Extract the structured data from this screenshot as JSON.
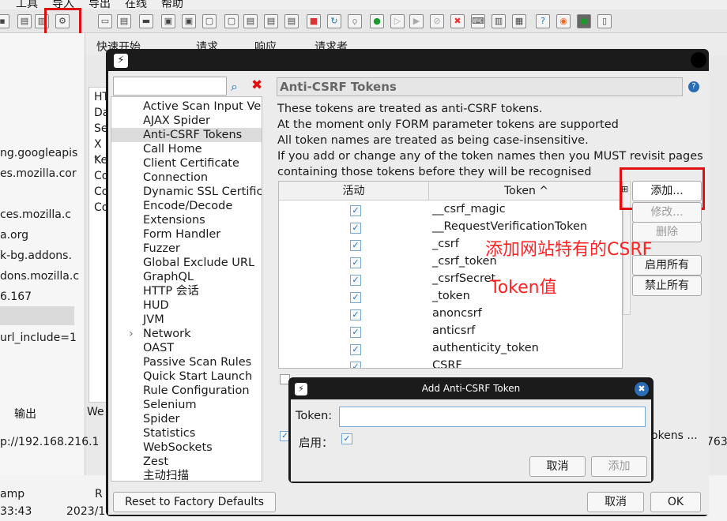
{
  "menubar": {
    "items": [
      "工具",
      "导入",
      "导出",
      "在线",
      "帮助"
    ]
  },
  "section_toolbar": {
    "quick_start": "快速开始",
    "request": "请求",
    "response": "响应",
    "requester": "请求者"
  },
  "left_panel": {
    "items": [
      "ng.googleapis",
      "es.mozilla.cor",
      "ces.mozilla.c",
      "a.org",
      "k-bg.addons.",
      "dons.mozilla.c",
      "6.167",
      "url_include=1"
    ]
  },
  "mid_panel": {
    "items": [
      "HT",
      "Da",
      "Se",
      "X -",
      "Ke",
      "Co",
      "Co",
      "Co"
    ]
  },
  "options_dialog": {
    "tree": [
      "Active Scan Input Vec",
      "AJAX Spider",
      "Anti-CSRF Tokens",
      "Call Home",
      "Client Certificate",
      "Connection",
      "Dynamic SSL Certifica",
      "Encode/Decode",
      "Extensions",
      "Form Handler",
      "Fuzzer",
      "Global Exclude URL",
      "GraphQL",
      "HTTP 会话",
      "HUD",
      "JVM",
      "Network",
      "OAST",
      "Passive Scan Rules",
      "Quick Start Launch",
      "Rule Configuration",
      "Selenium",
      "Spider",
      "Statistics",
      "WebSockets",
      "Zest",
      "主动扫描"
    ],
    "title": "Anti-CSRF Tokens",
    "description": [
      "These tokens are treated as anti-CSRF tokens.",
      "At the moment only FORM parameter tokens are supported",
      "All token names are treated as being case-insensitive.",
      "If you add or change any of the token names then you MUST revisit pages",
      "containing those tokens before they will be recognised"
    ],
    "table": {
      "col_enabled": "活动",
      "col_token": "Token ^",
      "rows": [
        "__csrf_magic",
        "__RequestVerificationToken",
        "_csrf",
        "_csrf_token",
        "_csrfSecret",
        "_token",
        "anoncsrf",
        "anticsrf",
        "authenticity_token",
        "CSRF"
      ]
    },
    "buttons": {
      "add": "添加...",
      "modify": "修改...",
      "remove": "删除",
      "enable_all": "启用所有",
      "disable_all": "禁止所有"
    },
    "annotation": [
      "添加网站特有的CSRF",
      "Token值"
    ],
    "footer": {
      "reset": "Reset to Factory Defaults",
      "cancel": "取消",
      "ok": "OK"
    },
    "hidden_text": "okens ..."
  },
  "add_dialog": {
    "title": "Add Anti-CSRF Token",
    "token_label": "Token:",
    "token_value": "",
    "enabled_label": "启用：",
    "cancel": "取消",
    "add": "添加"
  },
  "status": {
    "output": "输出",
    "websockets": "We",
    "url": "p://192.168.216.1",
    "col1": "amp",
    "col2": "R",
    "time": "33:43",
    "date": "2023/1",
    "right_num": "763"
  }
}
